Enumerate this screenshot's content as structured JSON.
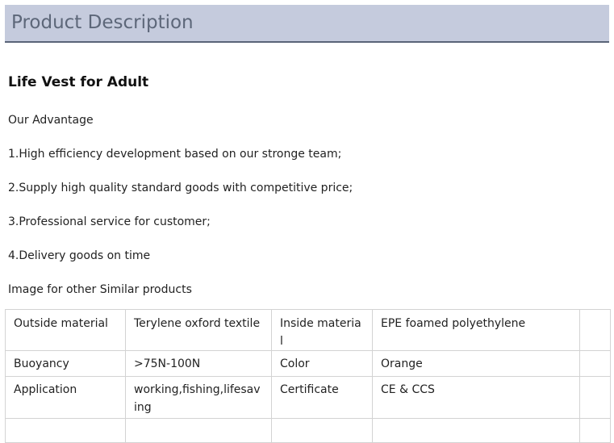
{
  "header": {
    "title": "Product Description"
  },
  "product": {
    "title": "Life Vest for Adult"
  },
  "content": {
    "advantage_heading": "Our Advantage",
    "points": [
      "1.High efficiency development based on our stronge team;",
      "2.Supply high quality standard goods with competitive price;",
      "3.Professional service for customer;",
      "4.Delivery goods on time"
    ],
    "similar_heading": "Image for other Similar products"
  },
  "spec_table": {
    "rows": [
      [
        "Outside material",
        "Terylene oxford textile",
        "Inside material",
        "EPE foamed polyethylene",
        ""
      ],
      [
        "Buoyancy",
        ">75N-100N",
        "Color",
        "Orange",
        ""
      ],
      [
        "Application",
        "working,fishing,lifesaving",
        "Certificate",
        "CE & CCS",
        ""
      ],
      [
        "",
        "",
        "",
        "",
        ""
      ]
    ]
  }
}
